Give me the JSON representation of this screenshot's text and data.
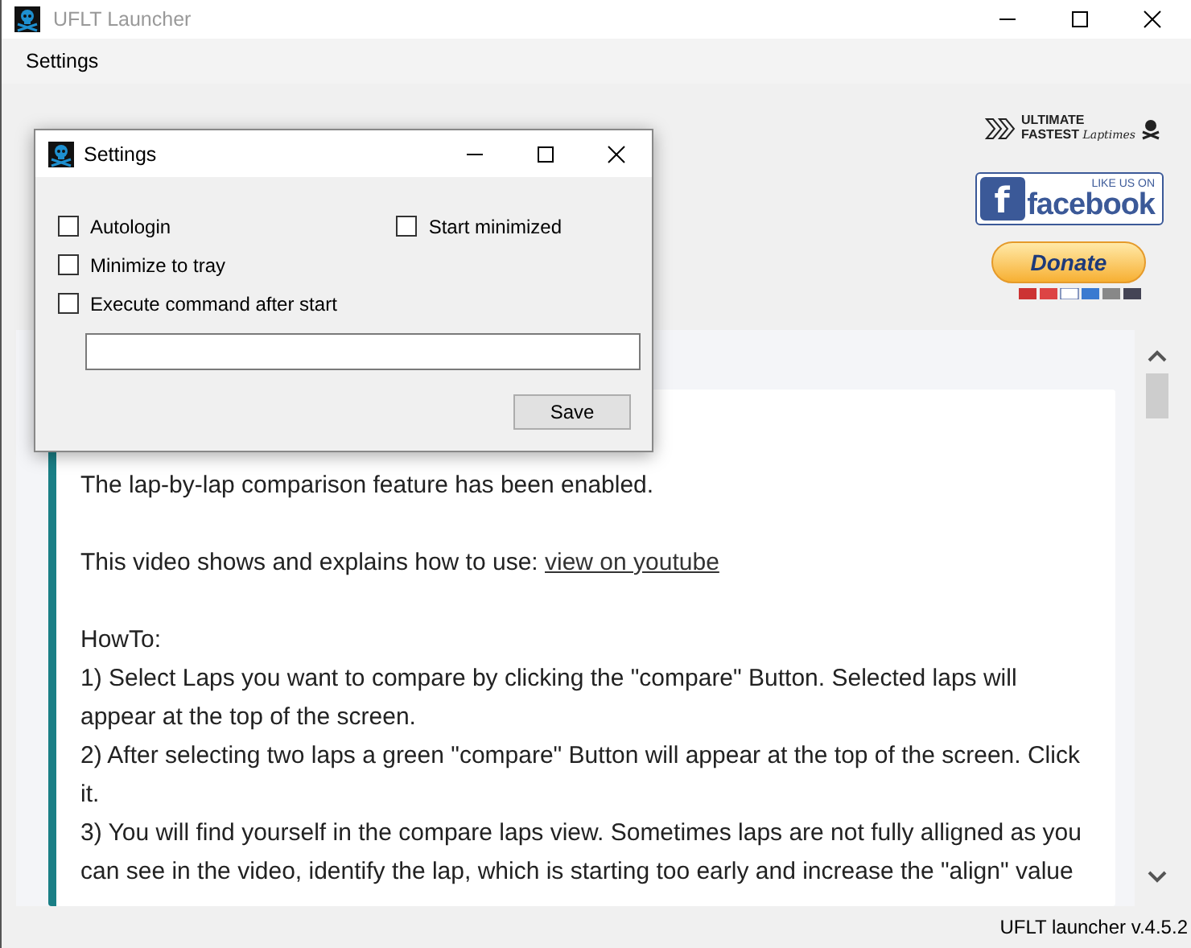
{
  "window": {
    "title": "UFLT Launcher"
  },
  "menu": [
    {
      "label": "Settings"
    }
  ],
  "branding": {
    "logo_line_1": "ULTIMATE",
    "logo_line_2": "FASTEST",
    "logo_line_3": "Laptimes",
    "facebook_icon": "f",
    "facebook_top": "LIKE US ON",
    "facebook_brand": "facebook",
    "donate_label": "Donate"
  },
  "article": {
    "paragraphs": [
      {
        "kind": "text",
        "text": "The lap-by-lap comparison feature has been enabled."
      },
      {
        "kind": "link",
        "text": "This video shows and explains how to use: ",
        "link": "view on youtube"
      },
      {
        "kind": "list",
        "text": "HowTo:",
        "items": [
          "1) Select Laps you want to compare by clicking the \"compare\" Button. Selected laps will appear at the top of the screen.",
          "2) After selecting two laps a green \"compare\" Button will appear at the top of the screen. Click it.",
          "3) You will find yourself in the compare laps view. Sometimes laps are not fully alligned as you can see in the video, identify the lap, which is starting too early and increase the \"align\" value"
        ]
      }
    ]
  },
  "status_bar": "UFLT launcher v.4.5.2",
  "dialog": {
    "title": "Settings",
    "left_options": [
      {
        "label": "Autologin",
        "checked": false
      },
      {
        "label": "Minimize to tray",
        "checked": false
      },
      {
        "label": "Execute command after start",
        "checked": false
      }
    ],
    "right_options": [
      {
        "label": "Start minimized",
        "checked": false
      }
    ],
    "save_label": "Save"
  }
}
